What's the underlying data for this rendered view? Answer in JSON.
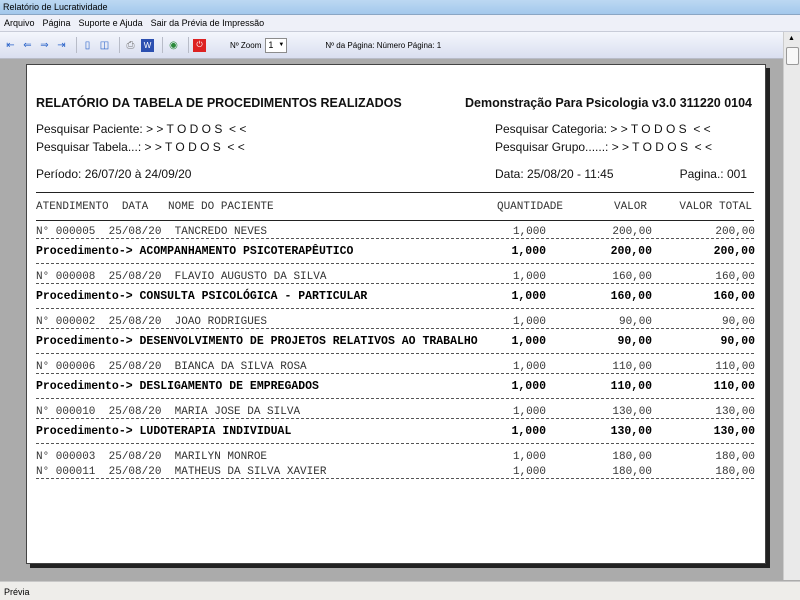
{
  "window": {
    "title": "Relatório de Lucratividade"
  },
  "menu": [
    "Arquivo",
    "Página",
    "Suporte e Ajuda",
    "Sair da Prévia de Impressão"
  ],
  "toolbar": {
    "zoom_label": "Nº Zoom",
    "zoom_value": "1",
    "page_label": "Nº da Página: Número Página: 1"
  },
  "report": {
    "title": "RELATÓRIO DA TABELA DE PROCEDIMENTOS REALIZADOS",
    "company": "Demonstração Para Psicologia v3.0 311220 0104",
    "filter_paciente": "Pesquisar Paciente: > > T O D O S  < <",
    "filter_tabela": "Pesquisar Tabela...: > > T O D O S  < <",
    "filter_categoria": "Pesquisar Categoria: > > T O D O S  < <",
    "filter_grupo": "Pesquisar Grupo......: > > T O D O S  < <",
    "periodo": "Período: 26/07/20 à 24/09/20",
    "data": "Data: 25/08/20 - 11:45",
    "pagina": "Pagina.: 001",
    "columns": {
      "left": "ATENDIMENTO  DATA   NOME DO PACIENTE",
      "qty": "QUANTIDADE",
      "valor": "VALOR",
      "total": "VALOR TOTAL"
    },
    "groups": [
      {
        "rows": [
          {
            "text": "N° 000005  25/08/20  TANCREDO NEVES",
            "qty": "1,000",
            "valor": "200,00",
            "total": "200,00"
          }
        ],
        "proc": {
          "text": "Procedimento-> ACOMPANHAMENTO PSICOTERAPÊUTICO",
          "qty": "1,000",
          "valor": "200,00",
          "total": "200,00"
        }
      },
      {
        "rows": [
          {
            "text": "N° 000008  25/08/20  FLAVIO AUGUSTO DA SILVA",
            "qty": "1,000",
            "valor": "160,00",
            "total": "160,00"
          }
        ],
        "proc": {
          "text": "Procedimento-> CONSULTA PSICOLÓGICA - PARTICULAR",
          "qty": "1,000",
          "valor": "160,00",
          "total": "160,00"
        }
      },
      {
        "rows": [
          {
            "text": "N° 000002  25/08/20  JOAO RODRIGUES",
            "qty": "1,000",
            "valor": "90,00",
            "total": "90,00"
          }
        ],
        "proc": {
          "text": "Procedimento-> DESENVOLVIMENTO DE PROJETOS RELATIVOS AO TRABALHO",
          "qty": "1,000",
          "valor": "90,00",
          "total": "90,00"
        }
      },
      {
        "rows": [
          {
            "text": "N° 000006  25/08/20  BIANCA DA SILVA ROSA",
            "qty": "1,000",
            "valor": "110,00",
            "total": "110,00"
          }
        ],
        "proc": {
          "text": "Procedimento-> DESLIGAMENTO DE EMPREGADOS",
          "qty": "1,000",
          "valor": "110,00",
          "total": "110,00"
        }
      },
      {
        "rows": [
          {
            "text": "N° 000010  25/08/20  MARIA JOSE DA SILVA",
            "qty": "1,000",
            "valor": "130,00",
            "total": "130,00"
          }
        ],
        "proc": {
          "text": "Procedimento-> LUDOTERAPIA INDIVIDUAL",
          "qty": "1,000",
          "valor": "130,00",
          "total": "130,00"
        }
      },
      {
        "rows": [
          {
            "text": "N° 000003  25/08/20  MARILYN MONROE",
            "qty": "1,000",
            "valor": "180,00",
            "total": "180,00"
          },
          {
            "text": "N° 000011  25/08/20  MATHEUS DA SILVA XAVIER",
            "qty": "1,000",
            "valor": "180,00",
            "total": "180,00"
          }
        ]
      }
    ]
  },
  "status": {
    "text": "Prévia"
  }
}
